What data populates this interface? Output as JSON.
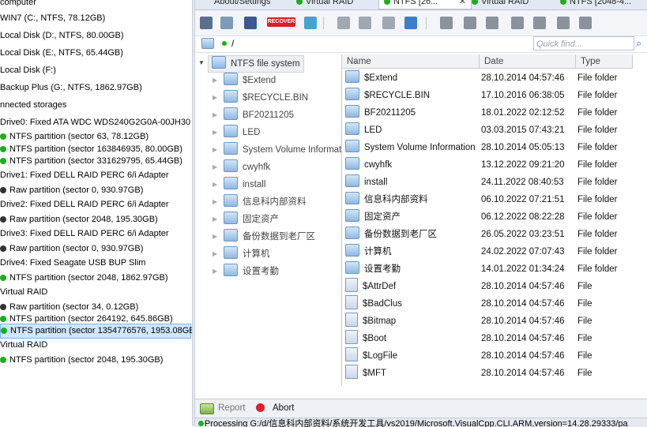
{
  "devices": {
    "items": [
      {
        "label": "computer"
      },
      {
        "label": "WIN7 (C:, NTFS, 78.12GB)"
      },
      {
        "label": "Local Disk (D:, NTFS, 80.00GB)"
      },
      {
        "label": "Local Disk (E:, NTFS, 65.44GB)"
      },
      {
        "label": "Local Disk (F:)"
      },
      {
        "label": "Backup Plus (G:, NTFS, 1862.97GB)"
      },
      {
        "label": "nnected storages"
      },
      {
        "label": "Drive0: Fixed ATA WDC WDS240G2G0A-00JH30"
      },
      {
        "label": "NTFS partition (sector 63, 78.12GB)"
      },
      {
        "label": "NTFS partition (sector 163846935, 80.00GB)"
      },
      {
        "label": "NTFS partition (sector 331629795, 65.44GB)"
      },
      {
        "label": "Drive1: Fixed DELL RAID PERC 6/i Adapter"
      },
      {
        "label": "Raw partition (sector 0, 930.97GB)"
      },
      {
        "label": "Drive2: Fixed DELL RAID PERC 6/i Adapter"
      },
      {
        "label": "Raw partition (sector 2048, 195.30GB)"
      },
      {
        "label": "Drive3: Fixed DELL RAID PERC 6/i Adapter"
      },
      {
        "label": "Raw partition (sector 0, 930.97GB)"
      },
      {
        "label": "Drive4: Fixed Seagate USB BUP Slim"
      },
      {
        "label": "NTFS partition (sector 2048, 1862.97GB)"
      },
      {
        "label": "Virtual RAID"
      },
      {
        "label": "Raw partition (sector 34, 0.12GB)"
      },
      {
        "label": "NTFS partition (sector 264192, 645.86GB)"
      },
      {
        "label": "NTFS partition (sector 1354776576, 1953.08GB)"
      },
      {
        "label": "Virtual RAID"
      },
      {
        "label": "NTFS partition (sector 2048, 195.30GB)"
      }
    ]
  },
  "tabs": [
    {
      "label": "About/Settings"
    },
    {
      "label": "Virtual RAID"
    },
    {
      "label": "NTFS [26..."
    },
    {
      "label": "Virtual RAID"
    },
    {
      "label": "NTFS [2048-4..."
    }
  ],
  "toolbar": {
    "recover_label": "RECOVER"
  },
  "path": {
    "value": "/"
  },
  "search": {
    "placeholder": "Quick find..."
  },
  "tree": {
    "root": "NTFS file system",
    "children": [
      "$Extend",
      "$RECYCLE.BIN",
      "BF20211205",
      "LED",
      "System Volume Informatio",
      "cwyhfk",
      "install",
      "信息科内部资料",
      "固定资产",
      "备份数据到老厂区",
      "计算机",
      "设置考勤"
    ]
  },
  "files": {
    "columns": {
      "name": "Name",
      "date": "Date",
      "type": "Type"
    },
    "rows": [
      {
        "name": "$Extend",
        "date": "28.10.2014 04:57:46",
        "type": "File folder"
      },
      {
        "name": "$RECYCLE.BIN",
        "date": "17.10.2016 06:38:05",
        "type": "File folder"
      },
      {
        "name": "BF20211205",
        "date": "18.01.2022 02:12:52",
        "type": "File folder"
      },
      {
        "name": "LED",
        "date": "03.03.2015 07:43:21",
        "type": "File folder"
      },
      {
        "name": "System Volume Information",
        "date": "28.10.2014 05:05:13",
        "type": "File folder"
      },
      {
        "name": "cwyhfk",
        "date": "13.12.2022 09:21:20",
        "type": "File folder"
      },
      {
        "name": "install",
        "date": "24.11.2022 08:40:53",
        "type": "File folder"
      },
      {
        "name": "信息科内部资料",
        "date": "06.10.2022 07:21:51",
        "type": "File folder"
      },
      {
        "name": "固定资产",
        "date": "06.12.2022 08:22:28",
        "type": "File folder"
      },
      {
        "name": "备份数据到老厂区",
        "date": "26.05.2022 03:23:51",
        "type": "File folder"
      },
      {
        "name": "计算机",
        "date": "24.02.2022 07:07:43",
        "type": "File folder"
      },
      {
        "name": "设置考勤",
        "date": "14.01.2022 01:34:24",
        "type": "File folder"
      },
      {
        "name": "$AttrDef",
        "date": "28.10.2014 04:57:46",
        "type": "File"
      },
      {
        "name": "$BadClus",
        "date": "28.10.2014 04:57:46",
        "type": "File"
      },
      {
        "name": "$Bitmap",
        "date": "28.10.2014 04:57:46",
        "type": "File"
      },
      {
        "name": "$Boot",
        "date": "28.10.2014 04:57:46",
        "type": "File"
      },
      {
        "name": "$LogFile",
        "date": "28.10.2014 04:57:46",
        "type": "File"
      },
      {
        "name": "$MFT",
        "date": "28.10.2014 04:57:46",
        "type": "File"
      }
    ]
  },
  "bottom": {
    "report_label": "Report",
    "abort_label": "Abort"
  },
  "status": {
    "text": "Processing G:/d/信息科内部资料/系统开发工具/vs2019/Microsoft.VisualCpp.CLI.ARM,version=14.28.29333/pa"
  },
  "colors": {
    "status_ok": "#19b019",
    "abort": "#e0202a",
    "recover": "#d62121"
  }
}
